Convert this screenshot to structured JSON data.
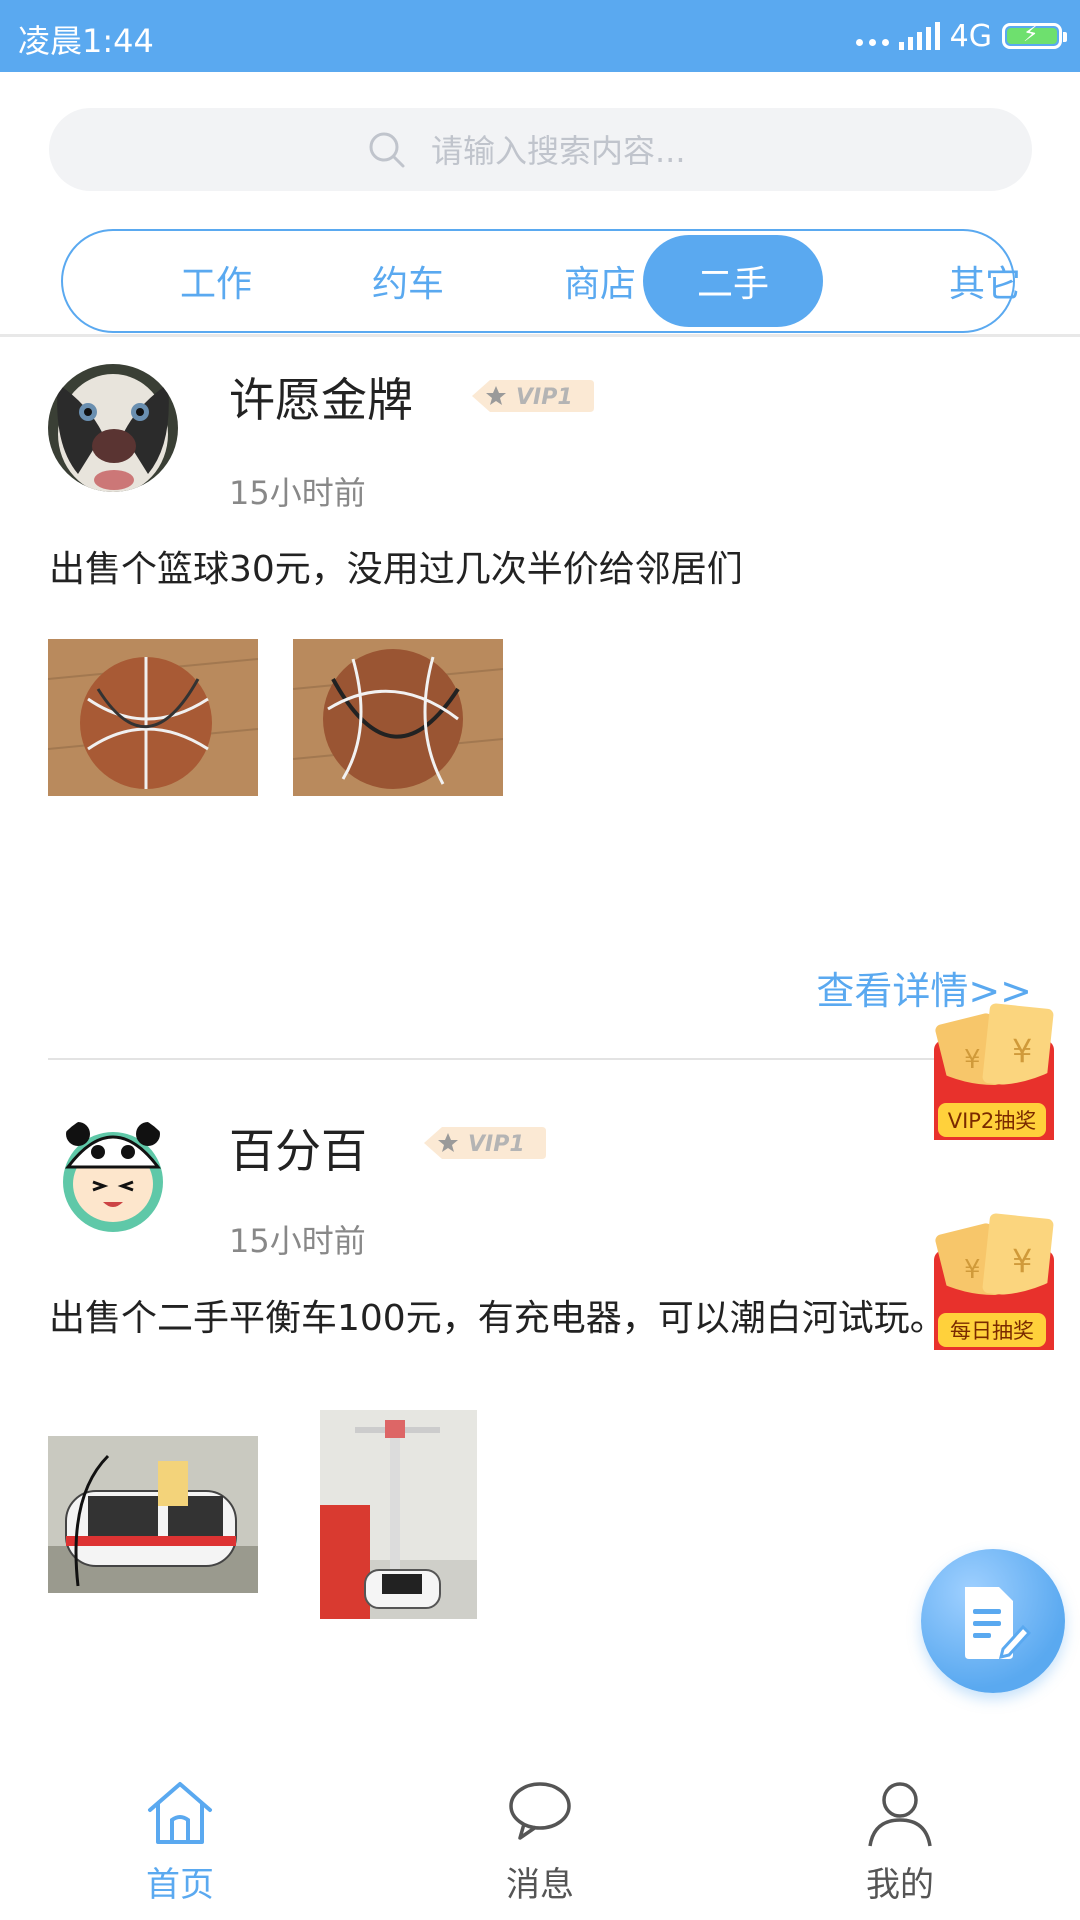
{
  "status_bar": {
    "time": "凌晨1:44",
    "network": "4G"
  },
  "search": {
    "placeholder": "请输入搜索内容..."
  },
  "tabs": [
    {
      "label": "工作",
      "active": false
    },
    {
      "label": "约车",
      "active": false
    },
    {
      "label": "商店",
      "active": false
    },
    {
      "label": "二手",
      "active": true
    },
    {
      "label": "其它",
      "active": false
    }
  ],
  "posts": [
    {
      "username": "许愿金牌",
      "vip": "VIP1",
      "time": "15小时前",
      "content": "出售个篮球30元，没用过几次半价给邻居们",
      "details_link": "查看详情>>"
    },
    {
      "username": "百分百",
      "vip": "VIP1",
      "time": "15小时前",
      "content": "出售个二手平衡车100元，有充电器，可以潮白河试玩。"
    }
  ],
  "floating": {
    "vip_lottery": "VIP2抽奖",
    "daily_lottery": "每日抽奖"
  },
  "bottom_nav": [
    {
      "label": "首页",
      "active": true
    },
    {
      "label": "消息",
      "active": false
    },
    {
      "label": "我的",
      "active": false
    }
  ],
  "colors": {
    "primary": "#5aa9f0",
    "lottery_red": "#e8312c",
    "lottery_gold": "#ffd13b"
  }
}
